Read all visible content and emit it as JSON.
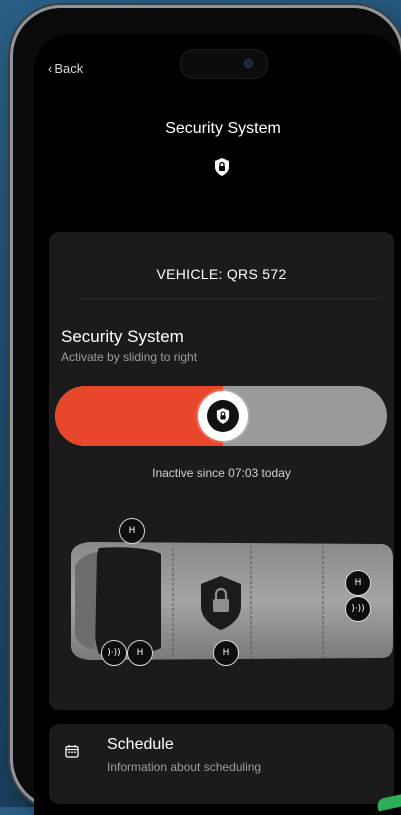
{
  "nav": {
    "back_label": "Back"
  },
  "header": {
    "title": "Security System",
    "icon": "lock-shield-icon"
  },
  "vehicle": {
    "label": "VEHICLE: QRS 572"
  },
  "security": {
    "title": "Security System",
    "subtitle": "Activate by sliding to right",
    "slider_fraction": 0.5,
    "status": "Inactive since 07:03 today",
    "accent_color": "#e9472c"
  },
  "sensors": {
    "door_glyph": "H",
    "alarm_glyph": ")·))"
  },
  "schedule": {
    "label": "Schedule",
    "sub": "Information about scheduling",
    "icon": "calendar-icon"
  }
}
